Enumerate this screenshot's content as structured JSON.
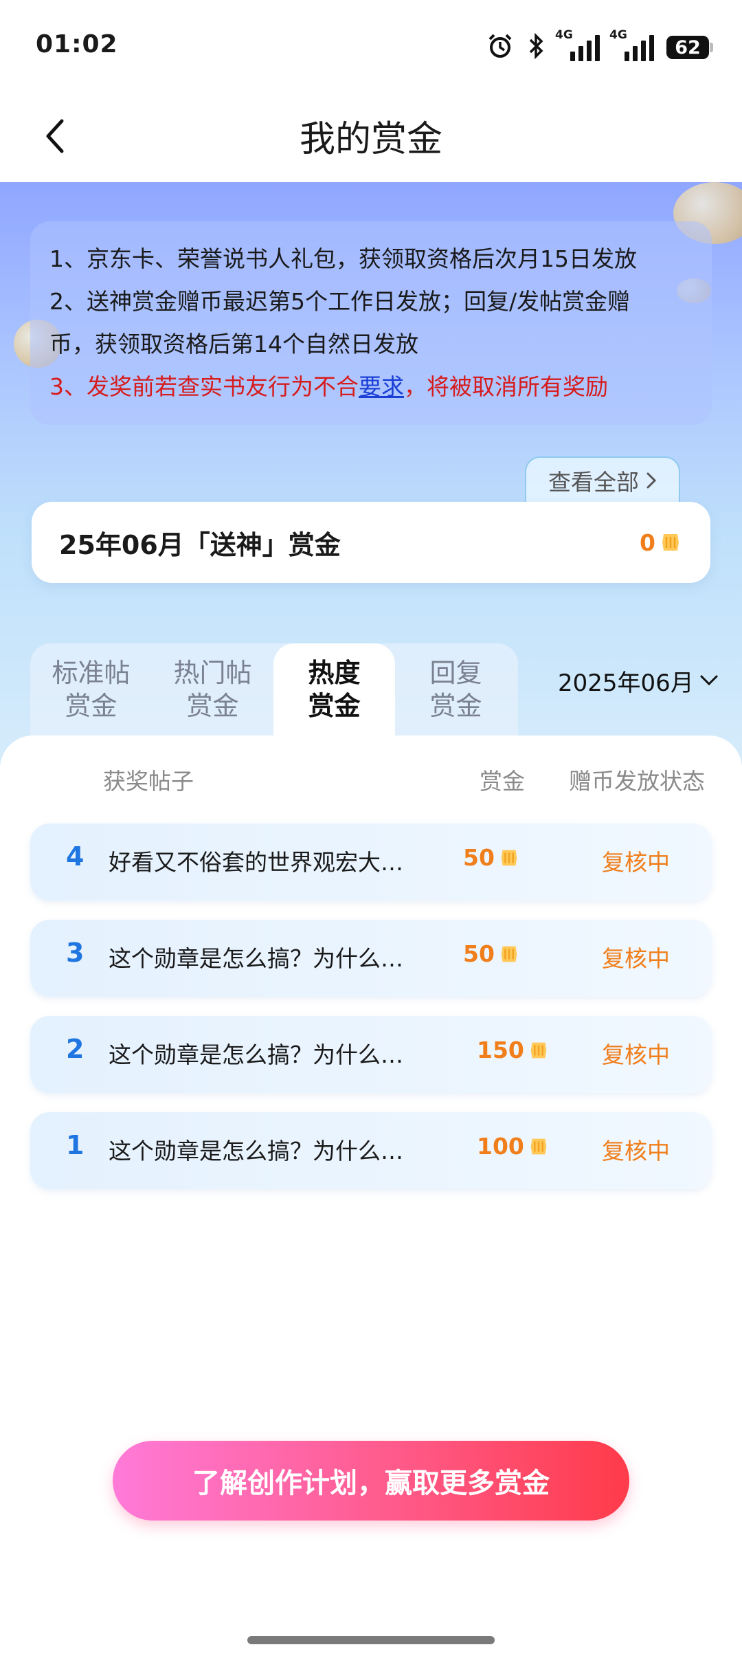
{
  "status_bar": {
    "time": "01:02",
    "signal1_label": "4G",
    "signal2_label": "4G",
    "battery": "62"
  },
  "nav": {
    "title": "我的赏金"
  },
  "notice": {
    "line1": "1、京东卡、荣誉说书人礼包，获领取资格后次月15日发放",
    "line2a": "2、送神赏金赠币最迟第5个工作日发放；回复/发帖赏金赠",
    "line2b": "币，获领取资格后第14个自然日发放",
    "line3_before": "3、发奖前若查实书友行为不合",
    "line3_link": "要求",
    "line3_after": "，将被取消所有奖励"
  },
  "view_all": "查看全部",
  "bounty_card": {
    "title": "25年06月「送神」赏金",
    "amount": "0"
  },
  "tabs": [
    {
      "line1": "标准帖",
      "line2": "赏金"
    },
    {
      "line1": "热门帖",
      "line2": "赏金"
    },
    {
      "line1": "热度",
      "line2": "赏金"
    },
    {
      "line1": "回复",
      "line2": "赏金"
    }
  ],
  "active_tab_index": 2,
  "month": "2025年06月",
  "table": {
    "headers": {
      "post": "获奖帖子",
      "bounty": "赏金",
      "status": "赠币发放状态"
    },
    "rows": [
      {
        "rank": "4",
        "title": "好看又不俗套的世界观宏大…",
        "amount": "50",
        "status": "复核中"
      },
      {
        "rank": "3",
        "title": "这个勋章是怎么搞？为什么…",
        "amount": "50",
        "status": "复核中"
      },
      {
        "rank": "2",
        "title": "这个勋章是怎么搞？为什么…",
        "amount": "150",
        "status": "复核中"
      },
      {
        "rank": "1",
        "title": "这个勋章是怎么搞？为什么…",
        "amount": "100",
        "status": "复核中"
      }
    ]
  },
  "cta": "了解创作计划，赢取更多赏金",
  "colors": {
    "accent_orange": "#f07e1a",
    "rank_blue": "#1f76e0",
    "notice_red": "#d61c1c",
    "cta_start": "#ff7ad8",
    "cta_end": "#ff3b4a"
  }
}
